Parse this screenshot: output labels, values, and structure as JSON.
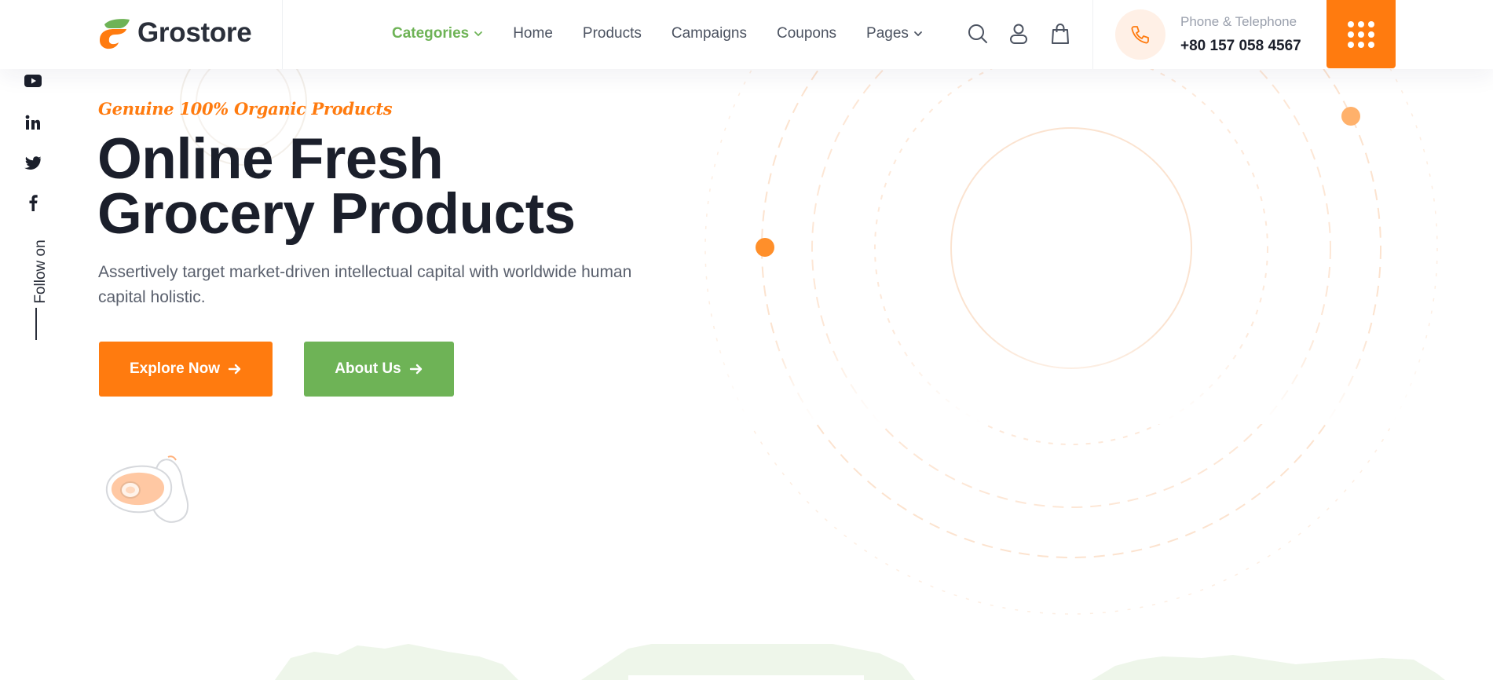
{
  "brand": {
    "name": "Grostore",
    "primary_color": "#ff7b0f",
    "secondary_color": "#6eb356",
    "text_color": "#1b1f2b"
  },
  "nav": {
    "items": [
      {
        "label": "Categories",
        "active": true,
        "has_dropdown": true
      },
      {
        "label": "Home",
        "active": false,
        "has_dropdown": false
      },
      {
        "label": "Products",
        "active": false,
        "has_dropdown": false
      },
      {
        "label": "Campaigns",
        "active": false,
        "has_dropdown": false
      },
      {
        "label": "Coupons",
        "active": false,
        "has_dropdown": false
      },
      {
        "label": "Pages",
        "active": false,
        "has_dropdown": true
      }
    ],
    "icons": [
      "search-icon",
      "user-icon",
      "shopping-bag-icon"
    ]
  },
  "contact": {
    "label": "Phone & Telephone",
    "number": "+80 157 058 4567",
    "icon": "phone-icon"
  },
  "menu_button": {
    "icon": "grid-menu-icon"
  },
  "social": {
    "follow_label": "Follow on",
    "icons": [
      "youtube-icon",
      "linkedin-icon",
      "twitter-icon",
      "facebook-icon"
    ]
  },
  "hero": {
    "tagline": "Genuine 100% Organic Products",
    "title_line_1": "Online Fresh",
    "title_line_2": "Grocery Products",
    "description": "Assertively target market-driven intellectual capital with worldwide human capital holistic.",
    "primary_button": "Explore Now",
    "secondary_button": "About Us",
    "illustration": "avocado-illustration"
  }
}
